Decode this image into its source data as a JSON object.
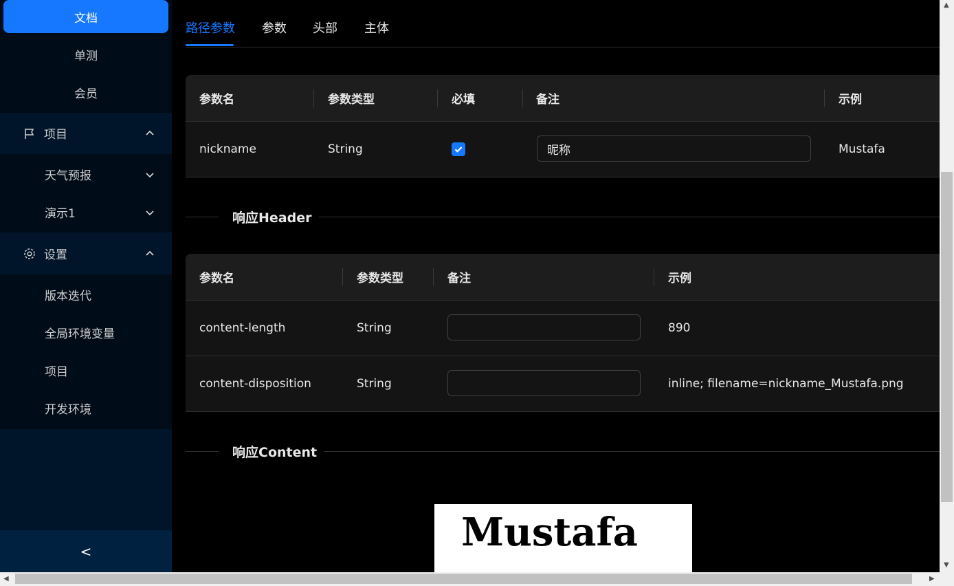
{
  "sidebar": {
    "items": [
      {
        "label": "文档"
      },
      {
        "label": "单测"
      },
      {
        "label": "会员"
      },
      {
        "label": "项目"
      },
      {
        "label": "天气预报"
      },
      {
        "label": "演示1"
      },
      {
        "label": "设置"
      },
      {
        "label": "版本迭代"
      },
      {
        "label": "全局环境变量"
      },
      {
        "label": "项目"
      },
      {
        "label": "开发环境"
      }
    ],
    "collapse_label": "<"
  },
  "tabs": [
    {
      "label": "路径参数"
    },
    {
      "label": "参数"
    },
    {
      "label": "头部"
    },
    {
      "label": "主体"
    }
  ],
  "params_table": {
    "headers": [
      "参数名",
      "参数类型",
      "必填",
      "备注",
      "示例"
    ],
    "rows": [
      {
        "name": "nickname",
        "type": "String",
        "required": true,
        "remark": "昵称",
        "example": "Mustafa"
      }
    ]
  },
  "response_header": {
    "title": "响应Header",
    "headers": [
      "参数名",
      "参数类型",
      "备注",
      "示例"
    ],
    "rows": [
      {
        "name": "content-length",
        "type": "String",
        "remark": "",
        "example": "890"
      },
      {
        "name": "content-disposition",
        "type": "String",
        "remark": "",
        "example": "inline; filename=nickname_Mustafa.png"
      }
    ]
  },
  "response_content": {
    "title": "响应Content",
    "image_text": "Mustafa"
  },
  "colors": {
    "accent": "#1677ff",
    "sidebar_bg": "#001529",
    "submenu_bg": "#000c17"
  }
}
